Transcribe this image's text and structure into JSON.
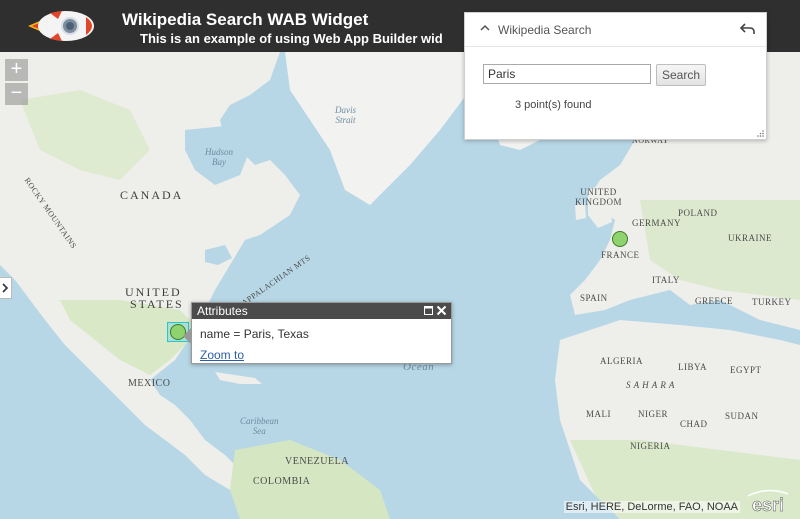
{
  "header": {
    "title": "Wikipedia Search WAB Widget",
    "subtitle": "This is an example of using Web App Builder wid"
  },
  "zoom": {
    "in_label": "+",
    "out_label": "−"
  },
  "widget": {
    "title": "Wikipedia Search",
    "search_value": "Paris",
    "search_button": "Search",
    "result_text": "3 point(s) found"
  },
  "popup": {
    "title": "Attributes",
    "content": "name = Paris, Texas",
    "zoom_link": "Zoom to"
  },
  "map_labels": {
    "canada": "CANADA",
    "us_line1": "UNITED",
    "us_line2": "STATES",
    "mexico": "MEXICO",
    "hudson_line1": "Hudson",
    "hudson_line2": "Bay",
    "davis_line1": "Davis",
    "davis_line2": "Strait",
    "ocean": "Ocean",
    "caribbean_line1": "Caribbean",
    "caribbean_line2": "Sea",
    "venezuela": "VENEZUELA",
    "colombia": "COLOMBIA",
    "uk_line1": "UNITED",
    "uk_line2": "KINGDOM",
    "norway": "NORWAY",
    "germany": "GERMANY",
    "poland": "POLAND",
    "ukraine": "UKRAINE",
    "france": "FRANCE",
    "spain": "SPAIN",
    "italy": "ITALY",
    "greece": "GREECE",
    "turkey": "TURKEY",
    "algeria": "ALGERIA",
    "libya": "LIBYA",
    "egypt": "EGYPT",
    "sahara": "S A H A R A",
    "mali": "MALI",
    "niger": "NIGER",
    "chad": "CHAD",
    "sudan": "SUDAN",
    "nigeria": "NIGERIA",
    "rocky": "ROCKY MOUNTAINS",
    "appalachian": "APPALACHIAN MTS"
  },
  "attribution": "Esri, HERE, DeLorme, FAO, NOAA",
  "esri_logo_text": "esri",
  "colors": {
    "header_bg": "#2f2f2f",
    "water": "#b7d7e6",
    "land": "#eeeeea",
    "vegetation": "#d5e7c2",
    "point_fill": "#8fd36e",
    "selected_outline": "#26c6da",
    "link": "#2b5ea7"
  }
}
